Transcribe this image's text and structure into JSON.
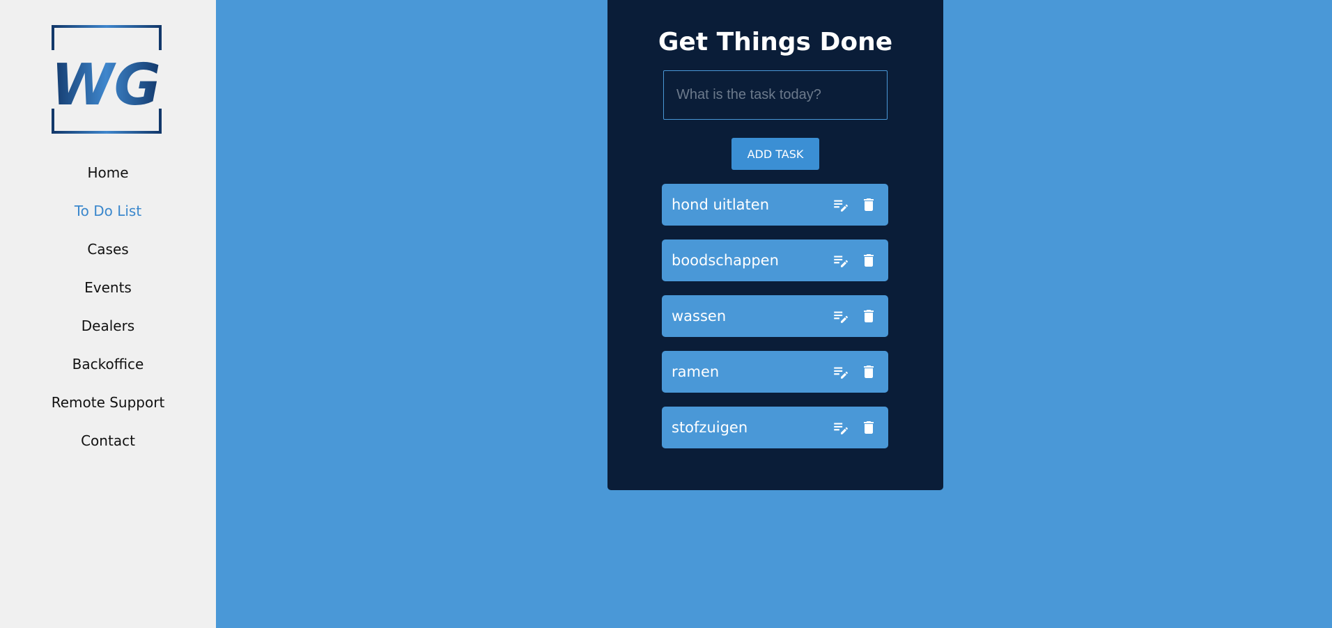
{
  "logo": {
    "text": "WG"
  },
  "nav": {
    "items": [
      {
        "label": "Home",
        "active": false
      },
      {
        "label": "To Do List",
        "active": true
      },
      {
        "label": "Cases",
        "active": false
      },
      {
        "label": "Events",
        "active": false
      },
      {
        "label": "Dealers",
        "active": false
      },
      {
        "label": "Backoffice",
        "active": false
      },
      {
        "label": "Remote Support",
        "active": false
      },
      {
        "label": "Contact",
        "active": false
      }
    ]
  },
  "todo": {
    "title": "Get Things Done",
    "input_placeholder": "What is the task today?",
    "input_value": "",
    "add_button_label": "ADD TASK",
    "items": [
      {
        "text": "hond uitlaten"
      },
      {
        "text": "boodschappen"
      },
      {
        "text": "wassen"
      },
      {
        "text": "ramen"
      },
      {
        "text": "stofzuigen"
      }
    ],
    "icons": {
      "edit": "edit-note-icon",
      "delete": "trash-icon"
    }
  },
  "colors": {
    "background": "#4a98d7",
    "sidebar": "#f0f0f0",
    "panel": "#0a1d38",
    "accent": "#3a87cc",
    "item": "#4a98d7"
  }
}
